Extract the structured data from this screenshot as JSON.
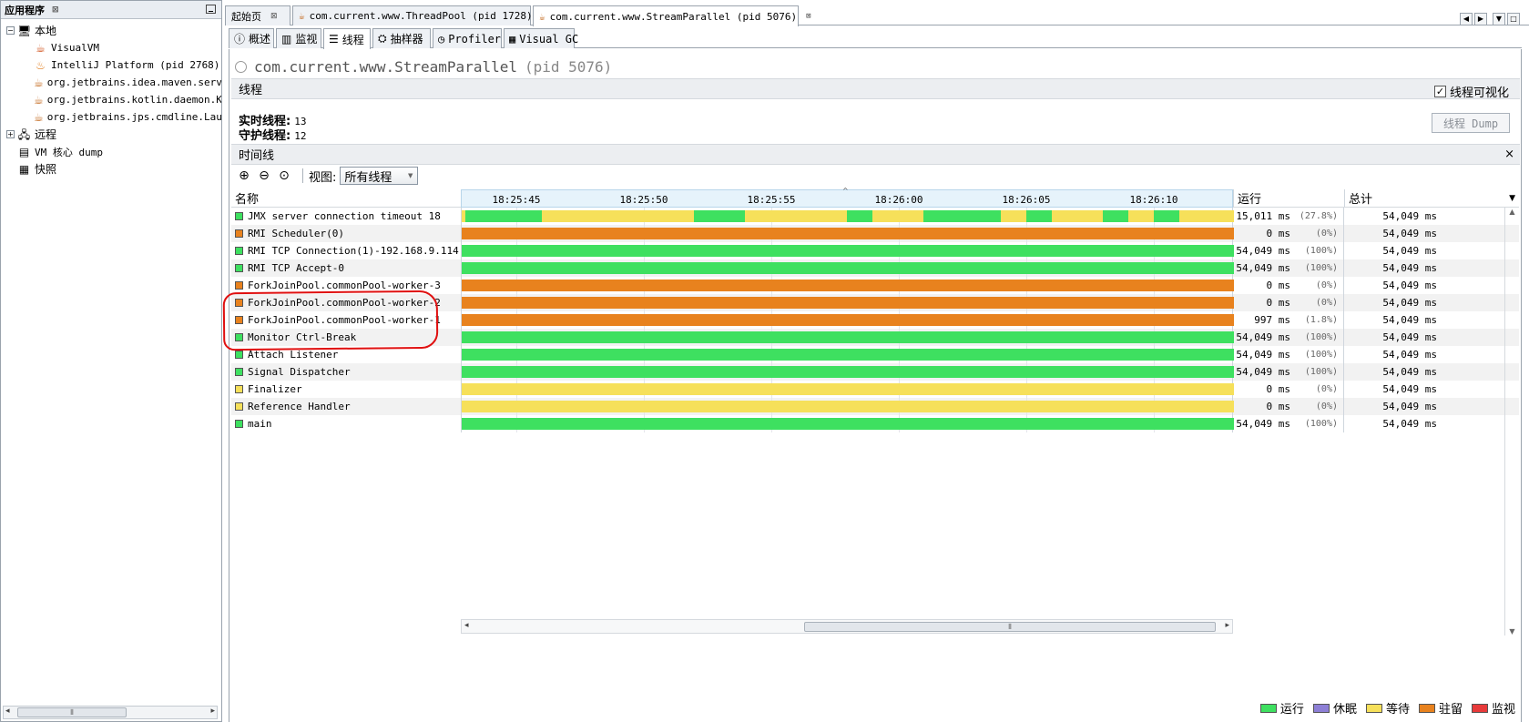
{
  "left_panel": {
    "title": "应用程序",
    "close": "⊠",
    "tree": [
      {
        "label": "本地",
        "icon": "computer-icon",
        "expander": "−"
      },
      {
        "label": "VisualVM",
        "icon": "visualvm-icon"
      },
      {
        "label": "IntelliJ Platform (pid 2768)",
        "icon": "intellij-icon"
      },
      {
        "label": "org.jetbrains.idea.maven.server",
        "icon": "java-icon"
      },
      {
        "label": "org.jetbrains.kotlin.daemon.Kot",
        "icon": "java-icon"
      },
      {
        "label": "org.jetbrains.jps.cmdline.Launc",
        "icon": "java-icon"
      },
      {
        "label": "远程",
        "icon": "network-icon",
        "expander": "+"
      },
      {
        "label": "VM 核心 dump",
        "icon": "coredump-icon"
      },
      {
        "label": "快照",
        "icon": "snapshot-icon"
      }
    ]
  },
  "doc_tabs": [
    {
      "label": "起始页",
      "close": "⊠"
    },
    {
      "label": "com.current.www.ThreadPool (pid 1728)",
      "close": "⊠"
    },
    {
      "label": "com.current.www.StreamParallel (pid 5076)",
      "close": "⊠"
    }
  ],
  "sub_tabs": [
    {
      "label": "概述"
    },
    {
      "label": "监视"
    },
    {
      "label": "线程"
    },
    {
      "label": "抽样器"
    },
    {
      "label": "Profiler"
    },
    {
      "label": "Visual GC"
    }
  ],
  "page": {
    "title": "com.current.www.StreamParallel",
    "pid": "(pid 5076)",
    "threads_section": "线程",
    "visualize_label": "线程可视化",
    "visualize_checked": true,
    "live_label": "实时线程:",
    "live_value": "13",
    "daemon_label": "守护线程:",
    "daemon_value": "12",
    "dump_button": "线程 Dump",
    "timeline_section": "时间线",
    "close": "×",
    "view_label": "视图:",
    "view_value": "所有线程"
  },
  "table": {
    "col_name": "名称",
    "col_run": "运行",
    "col_total": "总计",
    "ticks": [
      "18:25:45",
      "18:25:50",
      "18:25:55",
      "18:26:00",
      "18:26:05",
      "18:26:10"
    ],
    "rows": [
      {
        "name": "JMX server connection timeout 18",
        "state": "running",
        "run": "15,011 ms",
        "pct": "(27.8%)",
        "total": "54,049 ms"
      },
      {
        "name": "RMI Scheduler(0)",
        "state": "park",
        "run": "0 ms",
        "pct": "(0%)",
        "total": "54,049 ms"
      },
      {
        "name": "RMI TCP Connection(1)-192.168.9.114",
        "state": "running",
        "run": "54,049 ms",
        "pct": "(100%)",
        "total": "54,049 ms"
      },
      {
        "name": "RMI TCP Accept-0",
        "state": "running",
        "run": "54,049 ms",
        "pct": "(100%)",
        "total": "54,049 ms"
      },
      {
        "name": "ForkJoinPool.commonPool-worker-3",
        "state": "park",
        "run": "0 ms",
        "pct": "(0%)",
        "total": "54,049 ms"
      },
      {
        "name": "ForkJoinPool.commonPool-worker-2",
        "state": "park",
        "run": "0 ms",
        "pct": "(0%)",
        "total": "54,049 ms"
      },
      {
        "name": "ForkJoinPool.commonPool-worker-1",
        "state": "park",
        "run": "997 ms",
        "pct": "(1.8%)",
        "total": "54,049 ms"
      },
      {
        "name": "Monitor Ctrl-Break",
        "state": "running",
        "run": "54,049 ms",
        "pct": "(100%)",
        "total": "54,049 ms"
      },
      {
        "name": "Attach Listener",
        "state": "running",
        "run": "54,049 ms",
        "pct": "(100%)",
        "total": "54,049 ms"
      },
      {
        "name": "Signal Dispatcher",
        "state": "running",
        "run": "54,049 ms",
        "pct": "(100%)",
        "total": "54,049 ms"
      },
      {
        "name": "Finalizer",
        "state": "wait",
        "run": "0 ms",
        "pct": "(0%)",
        "total": "54,049 ms"
      },
      {
        "name": "Reference Handler",
        "state": "wait",
        "run": "0 ms",
        "pct": "(0%)",
        "total": "54,049 ms"
      },
      {
        "name": "main",
        "state": "running",
        "run": "54,049 ms",
        "pct": "(100%)",
        "total": "54,049 ms"
      }
    ]
  },
  "legend": [
    {
      "label": "运行",
      "color": "#3ee060"
    },
    {
      "label": "休眠",
      "color": "#8d7fd6"
    },
    {
      "label": "等待",
      "color": "#f6e05a"
    },
    {
      "label": "驻留",
      "color": "#e8821e"
    },
    {
      "label": "监视",
      "color": "#e83a3a"
    }
  ],
  "colors": {
    "running": "#3ee060",
    "park": "#e8821e",
    "wait": "#f6e05a",
    "sleep": "#8d7fd6",
    "monitor": "#e83a3a"
  }
}
